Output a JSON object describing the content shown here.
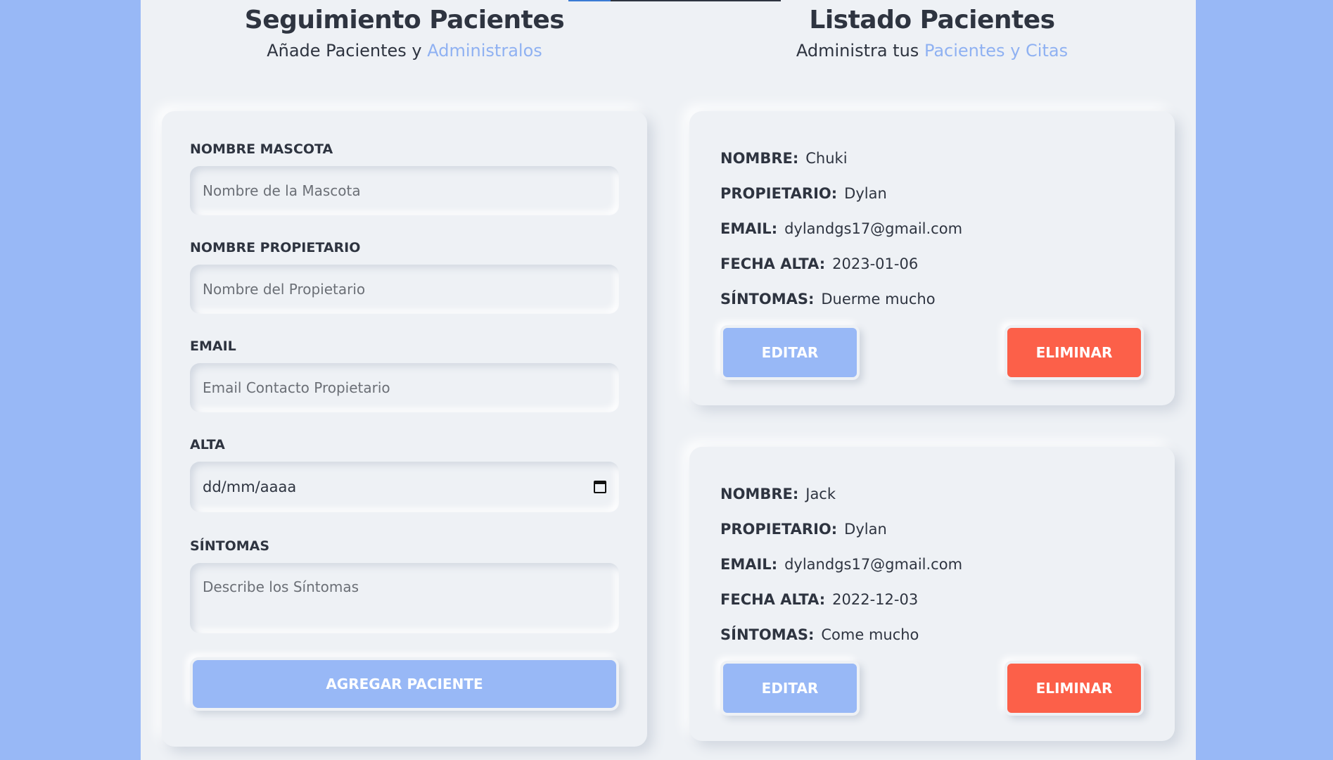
{
  "colors": {
    "page_background": "#98b8f6",
    "panel_background": "#eef1f5",
    "accent_blue": "#8fb1f2",
    "primary_button": "#98b8f6",
    "danger_button": "#fc6049",
    "text": "#2e3440"
  },
  "form_section": {
    "title": "Seguimiento Pacientes",
    "subtitle_prefix": "Añade Pacientes y ",
    "subtitle_accent": "Administralos",
    "fields": {
      "pet_name": {
        "label": "NOMBRE MASCOTA",
        "placeholder": "Nombre de la Mascota",
        "value": ""
      },
      "owner_name": {
        "label": "NOMBRE PROPIETARIO",
        "placeholder": "Nombre del Propietario",
        "value": ""
      },
      "email": {
        "label": "EMAIL",
        "placeholder": "Email Contacto Propietario",
        "value": ""
      },
      "discharge": {
        "label": "ALTA",
        "display_value": "dd/mm/aaaa",
        "icon": "calendar-icon"
      },
      "symptoms": {
        "label": "SÍNTOMAS",
        "placeholder": "Describe los Síntomas",
        "value": ""
      }
    },
    "submit_label": "AGREGAR PACIENTE"
  },
  "list_section": {
    "title": "Listado Pacientes",
    "subtitle_prefix": "Administra tus ",
    "subtitle_accent": "Pacientes y Citas",
    "labels": {
      "name": "NOMBRE:",
      "owner": "PROPIETARIO:",
      "email": "EMAIL:",
      "discharge_date": "FECHA ALTA:",
      "symptoms": "SÍNTOMAS:"
    },
    "edit_label": "EDITAR",
    "delete_label": "ELIMINAR",
    "patients": [
      {
        "name": "Chuki",
        "owner": "Dylan",
        "email": "dylandgs17@gmail.com",
        "discharge_date": "2023-01-06",
        "symptoms": "Duerme mucho"
      },
      {
        "name": "Jack",
        "owner": "Dylan",
        "email": "dylandgs17@gmail.com",
        "discharge_date": "2022-12-03",
        "symptoms": "Come mucho"
      }
    ]
  }
}
